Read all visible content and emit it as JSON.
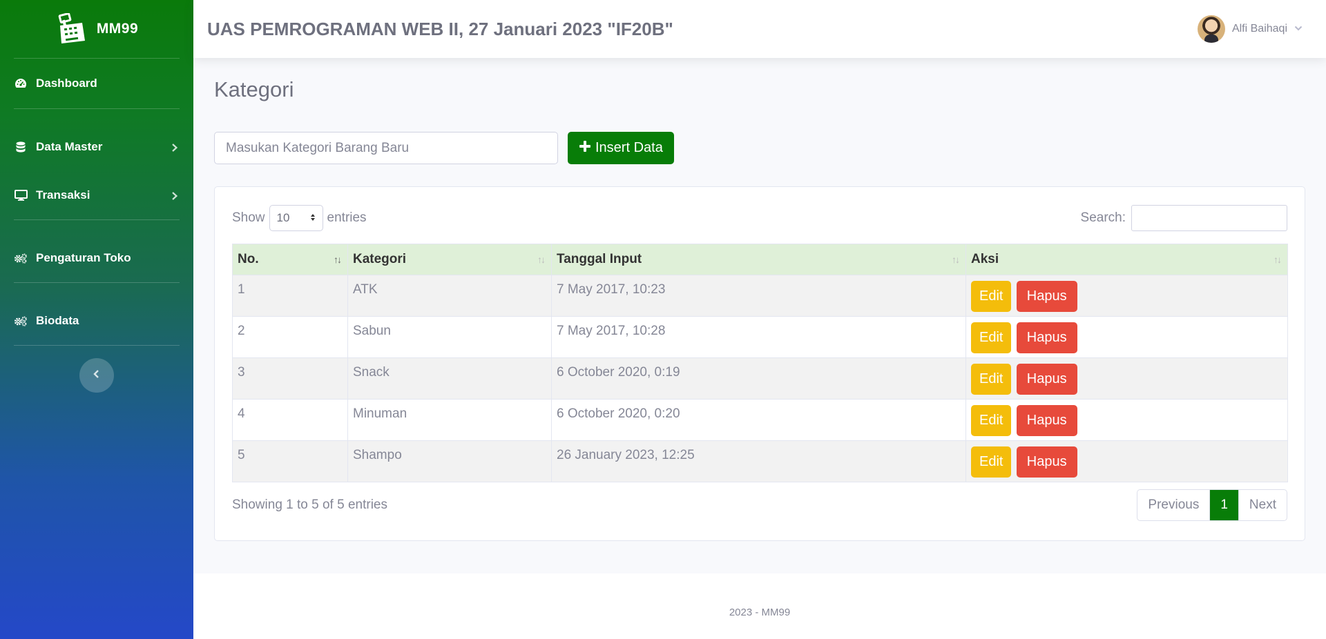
{
  "sidebar": {
    "brand": "MM99",
    "items": [
      {
        "label": "Dashboard"
      },
      {
        "label": "Data Master"
      },
      {
        "label": "Transaksi"
      },
      {
        "label": "Pengaturan Toko"
      },
      {
        "label": "Biodata"
      }
    ]
  },
  "header": {
    "title": "UAS PEMROGRAMAN WEB II, 27 Januari 2023 \"IF20B\"",
    "user_name": "Alfi Baihaqi"
  },
  "page": {
    "title": "Kategori",
    "input_placeholder": "Masukan Kategori Barang Baru",
    "insert_label": "Insert Data"
  },
  "datatable": {
    "show_label": "Show",
    "entries_value": "10",
    "entries_label": "entries",
    "search_label": "Search:",
    "columns": [
      "No.",
      "Kategori",
      "Tanggal Input",
      "Aksi"
    ],
    "rows": [
      {
        "no": "1",
        "kategori": "ATK",
        "tanggal": "7 May 2017, 10:23"
      },
      {
        "no": "2",
        "kategori": "Sabun",
        "tanggal": "7 May 2017, 10:28"
      },
      {
        "no": "3",
        "kategori": "Snack",
        "tanggal": "6 October 2020, 0:19"
      },
      {
        "no": "4",
        "kategori": "Minuman",
        "tanggal": "6 October 2020, 0:20"
      },
      {
        "no": "5",
        "kategori": "Shampo",
        "tanggal": "26 January 2023, 12:25"
      }
    ],
    "edit_label": "Edit",
    "hapus_label": "Hapus",
    "info": "Showing 1 to 5 of 5 entries",
    "prev_label": "Previous",
    "page_number": "1",
    "next_label": "Next"
  },
  "footer": {
    "text": "2023 - MM99"
  },
  "colors": {
    "brand_green": "#087d08",
    "edit_yellow": "#f4bd0b",
    "hapus_red": "#e74a3b",
    "table_header": "#dff0d8"
  }
}
